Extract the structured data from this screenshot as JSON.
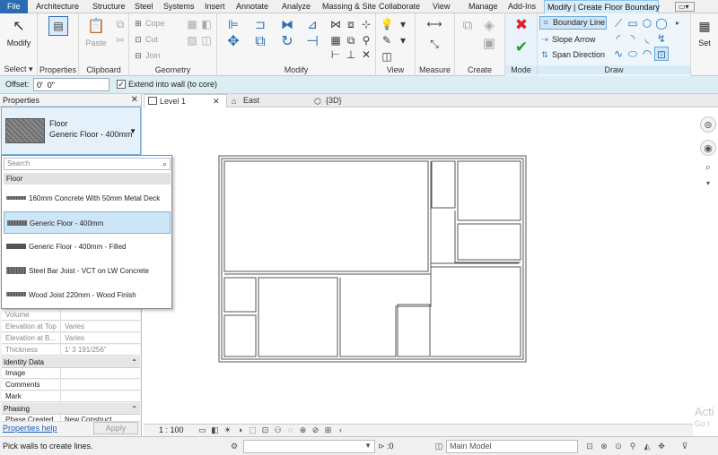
{
  "tabs": [
    "File",
    "Architecture",
    "Structure",
    "Steel",
    "Systems",
    "Insert",
    "Annotate",
    "Analyze",
    "Massing & Site",
    "Collaborate",
    "View",
    "Manage",
    "Add-Ins",
    "Modify | Create Floor Boundary"
  ],
  "ribbon": {
    "select": {
      "modify_label": "Modify",
      "title": "Select ▾"
    },
    "properties": {
      "title": "Properties"
    },
    "clipboard": {
      "paste_label": "Paste",
      "title": "Clipboard"
    },
    "geometry": {
      "cope": "Cope",
      "cut": "Cut",
      "join": "Join",
      "title": "Geometry"
    },
    "modify": {
      "title": "Modify"
    },
    "view": {
      "title": "View"
    },
    "measure": {
      "title": "Measure"
    },
    "create": {
      "title": "Create"
    },
    "mode": {
      "title": "Mode"
    },
    "draw": {
      "boundary_line": "Boundary Line",
      "slope_arrow": "Slope Arrow",
      "span_direction": "Span Direction",
      "title": "Draw",
      "set_label": "Set"
    }
  },
  "options": {
    "offset_label": "Offset:",
    "offset_value": "0'  0\"",
    "extend_label": "Extend into wall (to core)",
    "extend_checked": "✓"
  },
  "properties": {
    "title": "Properties",
    "type_family": "Floor",
    "type_name": "Generic Floor - 400mm",
    "rows_a": [
      {
        "k": "Volume",
        "v": ""
      },
      {
        "k": "Elevation at Top",
        "v": "Varies"
      },
      {
        "k": "Elevation at B...",
        "v": "Varies"
      },
      {
        "k": "Thickness",
        "v": "1'  3 191/256\""
      }
    ],
    "group_identity": "Identity Data",
    "rows_b": [
      {
        "k": "Image",
        "v": ""
      },
      {
        "k": "Comments",
        "v": ""
      },
      {
        "k": "Mark",
        "v": ""
      }
    ],
    "group_phasing": "Phasing",
    "row_phase": {
      "k": "Phase Created",
      "v": "New Construct"
    },
    "help_link": "Properties help",
    "apply_label": "Apply"
  },
  "dropdown": {
    "search_placeholder": "Search",
    "group": "Floor",
    "items": [
      "160mm Concrete With 50mm Metal Deck",
      "Generic Floor - 400mm",
      "Generic Floor - 400mm - Filled",
      "Steel Bar Joist - VCT on LW Concrete",
      "Wood Joist 220mm - Wood Finish"
    ],
    "selected_index": 1
  },
  "view_tabs": [
    {
      "label": "Level 1",
      "active": true
    },
    {
      "label": "East",
      "active": false
    },
    {
      "label": "{3D}",
      "active": false
    }
  ],
  "view_control": {
    "scale": "1 : 100"
  },
  "status": {
    "text": "Pick walls to create lines.",
    "selection_count": ":0",
    "model": "Main Model"
  },
  "watermark": {
    "line1": "Acti",
    "line2": "Go t"
  }
}
